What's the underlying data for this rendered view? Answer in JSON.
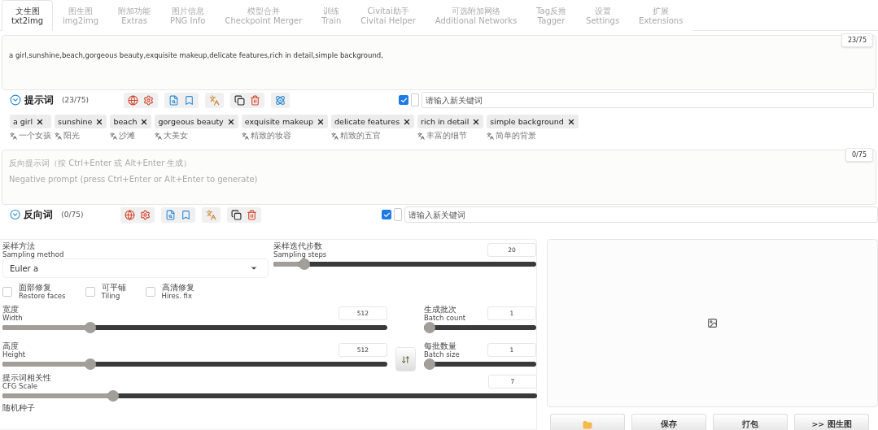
{
  "tabs": [
    {
      "label": "文生图",
      "sublabel": "txt2img",
      "selected": true
    },
    {
      "label": "图生图",
      "sublabel": "img2img",
      "selected": false
    },
    {
      "label": "附加功能",
      "sublabel": "Extras",
      "selected": false
    },
    {
      "label": "图片信息",
      "sublabel": "PNG Info",
      "selected": false
    },
    {
      "label": "模型合并",
      "sublabel": "Checkpoint Merger",
      "selected": false
    },
    {
      "label": "训练",
      "sublabel": "Train",
      "selected": false
    },
    {
      "label": "Civitai助手",
      "sublabel": "Civitai Helper",
      "selected": false
    },
    {
      "label": "可选附加网络",
      "sublabel": "Additional Networks",
      "selected": false
    },
    {
      "label": "Tag反推",
      "sublabel": "Tagger",
      "selected": false
    },
    {
      "label": "设置",
      "sublabel": "Settings",
      "selected": false
    },
    {
      "label": "扩展",
      "sublabel": "Extensions",
      "selected": false
    }
  ],
  "prompt": {
    "value": "a girl,sunshine,beach,gorgeous beauty,exquisite makeup,delicate features,rich in detail,simple background,",
    "counter": "23/75",
    "title": "提示词",
    "count": "(23/75)",
    "keyword_checked": true,
    "keyword_placeholder": "请输入新关键词",
    "tags": [
      {
        "text": "a girl",
        "translation": "一个女孩"
      },
      {
        "text": "sunshine",
        "translation": "阳光"
      },
      {
        "text": "beach",
        "translation": "沙滩"
      },
      {
        "text": "gorgeous beauty",
        "translation": "大美女"
      },
      {
        "text": "exquisite makeup",
        "translation": "精致的妆容"
      },
      {
        "text": "delicate features",
        "translation": "精致的五官"
      },
      {
        "text": "rich in detail",
        "translation": "丰富的细节"
      },
      {
        "text": "simple background",
        "translation": "简单的背景"
      }
    ]
  },
  "negative_prompt": {
    "placeholder": "反向提示词（按 Ctrl+Enter 或 Alt+Enter 生成）\nNegative prompt (press Ctrl+Enter or Alt+Enter to generate)",
    "counter": "0/75",
    "title": "反向词",
    "count": "(0/75)",
    "keyword_checked": true,
    "keyword_placeholder": "请输入新关键词"
  },
  "sampling_method": {
    "label": "采样方法",
    "sublabel": "Sampling method",
    "value": "Euler a"
  },
  "sampling_steps": {
    "label": "采样迭代步数",
    "sublabel": "Sampling steps",
    "value": "20",
    "level": 0.1
  },
  "options": [
    {
      "label": "面部修复",
      "sublabel": "Restore faces",
      "checked": false
    },
    {
      "label": "可平铺",
      "sublabel": "Tiling",
      "checked": false
    },
    {
      "label": "高清修复",
      "sublabel": "Hires. fix",
      "checked": false
    }
  ],
  "width": {
    "label": "宽度",
    "sublabel": "Width",
    "value": "512",
    "level": 0.22
  },
  "height": {
    "label": "高度",
    "sublabel": "Height",
    "value": "512",
    "level": 0.22
  },
  "batch_count": {
    "label": "生成批次",
    "sublabel": "Batch count",
    "value": "1",
    "level": 0
  },
  "batch_size": {
    "label": "每批数量",
    "sublabel": "Batch size",
    "value": "1",
    "level": 0
  },
  "cfg_scale": {
    "label": "提示词相关性",
    "sublabel": "CFG Scale",
    "value": "7",
    "level": 0.2
  },
  "seed": {
    "label": "随机种子"
  },
  "output_buttons": [
    {
      "kind": "folder"
    },
    {
      "kind": "text",
      "label": "保存"
    },
    {
      "kind": "text",
      "label": "打包"
    },
    {
      "kind": "text",
      "label": ">> 图生图"
    }
  ]
}
